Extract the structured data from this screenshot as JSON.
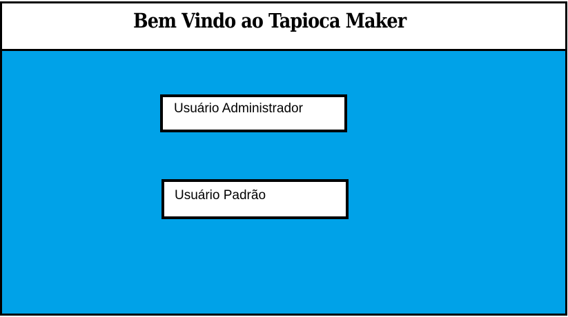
{
  "header": {
    "title": "Bem Vindo ao Tapioca Maker"
  },
  "options": {
    "admin_label": "Usuário Administrador",
    "standard_label": "Usuário Padrão"
  },
  "colors": {
    "background": "#00a2e8",
    "button_bg": "#ffffff",
    "border": "#000000"
  }
}
